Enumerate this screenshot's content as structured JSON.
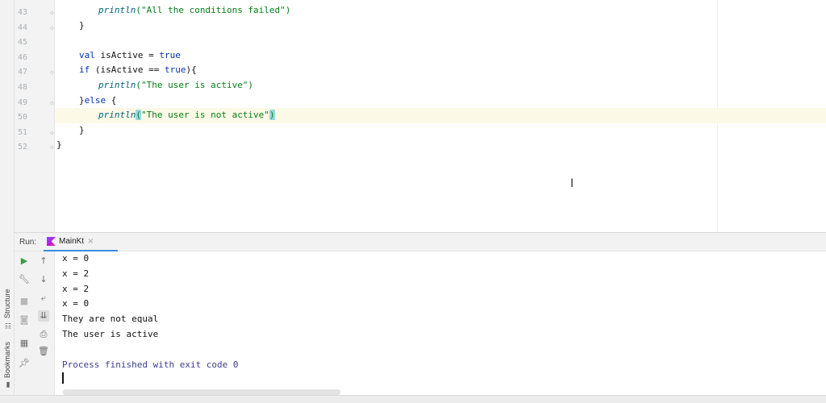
{
  "editor": {
    "lines": [
      {
        "num": "43",
        "tokens": [
          {
            "t": "    "
          },
          {
            "t": "println",
            "c": "fn"
          },
          {
            "t": "(\"All the conditions failed\")",
            "c": "str"
          }
        ]
      },
      {
        "num": "44",
        "tokens": [
          {
            "t": "}"
          }
        ]
      },
      {
        "num": "45",
        "tokens": []
      },
      {
        "num": "46",
        "tokens": [
          {
            "t": "val",
            "c": "kw"
          },
          {
            "t": " isActive = "
          },
          {
            "t": "true",
            "c": "kw"
          }
        ]
      },
      {
        "num": "47",
        "tokens": [
          {
            "t": "if",
            "c": "kw"
          },
          {
            "t": " (isActive == "
          },
          {
            "t": "true",
            "c": "kw"
          },
          {
            "t": "){"
          }
        ]
      },
      {
        "num": "48",
        "tokens": [
          {
            "t": "    "
          },
          {
            "t": "println",
            "c": "fn"
          },
          {
            "t": "(\"The user is active\")",
            "c": "str"
          }
        ]
      },
      {
        "num": "49",
        "tokens": [
          {
            "t": "}"
          },
          {
            "t": "else",
            "c": "kw"
          },
          {
            "t": " {"
          }
        ]
      },
      {
        "num": "50",
        "tokens": [
          {
            "t": "    "
          },
          {
            "t": "println",
            "c": "fn"
          },
          {
            "t": "(",
            "c": "hl"
          },
          {
            "t": "\"The user is not active\"",
            "c": "str"
          },
          {
            "t": ")",
            "c": "hl"
          }
        ]
      },
      {
        "num": "51",
        "tokens": [
          {
            "t": "}"
          }
        ]
      },
      {
        "num": "52",
        "tokens": [
          {
            "t": "}"
          }
        ]
      }
    ],
    "current_line": "50"
  },
  "run_panel": {
    "label": "Run:",
    "tab": {
      "label": "MainKt",
      "close": "×"
    },
    "output": [
      {
        "text": "x = 0",
        "kind": "out"
      },
      {
        "text": "x = 2",
        "kind": "out"
      },
      {
        "text": "x = 2",
        "kind": "out"
      },
      {
        "text": "x = 0",
        "kind": "out"
      },
      {
        "text": "They are not equal",
        "kind": "out"
      },
      {
        "text": "The user is active",
        "kind": "out"
      },
      {
        "text": "",
        "kind": "out"
      },
      {
        "text": "Process finished with exit code 0",
        "kind": "sys"
      }
    ]
  },
  "side_tabs": {
    "structure": "Structure",
    "bookmarks": "Bookmarks"
  },
  "icons": {
    "run": "play-icon",
    "settings": "wrench-icon",
    "stop": "stop-icon",
    "camera": "camera-icon",
    "pin": "pin-icon",
    "up": "arrow-up-icon",
    "down": "arrow-down-icon",
    "wrap": "soft-wrap-icon",
    "scroll_end": "scroll-to-end-icon",
    "print": "print-icon",
    "trash": "trash-icon"
  },
  "colors": {
    "keyword": "#0033b3",
    "string": "#067d17",
    "function": "#00627a",
    "current_line": "#fcfae6",
    "brace_highlight": "#99d7e0",
    "tab_underline": "#3d8de0"
  }
}
